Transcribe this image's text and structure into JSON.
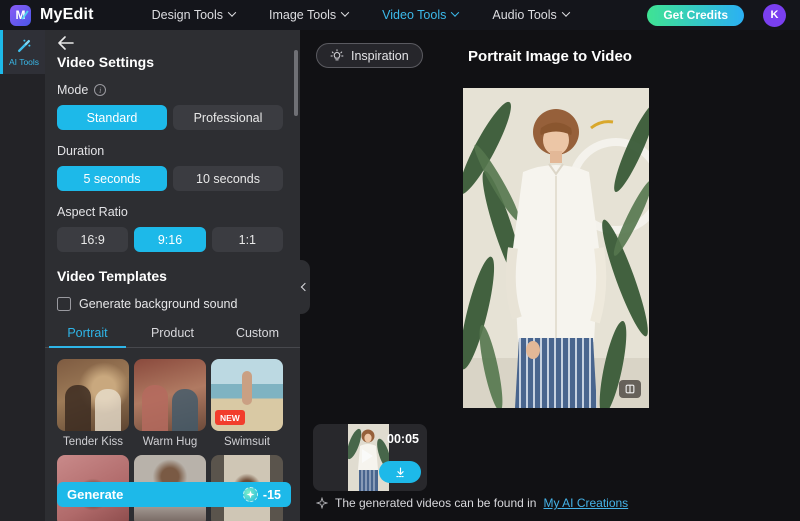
{
  "nav": {
    "logo_letter": "M",
    "brand": "MyEdit",
    "items": [
      {
        "label": "Design Tools",
        "active": false
      },
      {
        "label": "Image Tools",
        "active": false
      },
      {
        "label": "Video Tools",
        "active": true
      },
      {
        "label": "Audio Tools",
        "active": false
      }
    ],
    "get_credits_label": "Get Credits",
    "avatar_initial": "K"
  },
  "sidebar": {
    "items": [
      {
        "label": "AI Tools",
        "icon": "magic-wand-icon",
        "active": true
      }
    ]
  },
  "settings_panel": {
    "title": "Video Settings",
    "mode": {
      "label": "Mode",
      "options": [
        "Standard",
        "Professional"
      ],
      "selected": "Standard"
    },
    "duration": {
      "label": "Duration",
      "options": [
        "5 seconds",
        "10 seconds"
      ],
      "selected": "5 seconds"
    },
    "aspect_ratio": {
      "label": "Aspect Ratio",
      "options": [
        "16:9",
        "9:16",
        "1:1"
      ],
      "selected": "9:16"
    },
    "templates": {
      "title": "Video Templates",
      "background_sound_label": "Generate background sound",
      "background_sound_checked": false,
      "tabs": [
        {
          "label": "Portrait",
          "active": true
        },
        {
          "label": "Product",
          "active": false
        },
        {
          "label": "Custom",
          "active": false
        }
      ],
      "items": [
        {
          "name": "Tender Kiss"
        },
        {
          "name": "Warm Hug"
        },
        {
          "name": "Swimsuit",
          "badge": "NEW"
        }
      ]
    },
    "generate": {
      "label": "Generate",
      "cost": "-15"
    }
  },
  "main": {
    "inspiration_label": "Inspiration",
    "title": "Portrait Image to Video",
    "result": {
      "duration": "00:05"
    },
    "footnote": {
      "text": "The generated videos can be found in",
      "link": "My AI Creations"
    }
  },
  "colors": {
    "accent_cyan": "#1db9e9",
    "link_blue": "#45b3e8",
    "badge_new_red": "#f23d2c",
    "credits_gradient": [
      "#3fe393",
      "#2bb0f4"
    ],
    "avatar_purple": "#7a3ff0"
  }
}
